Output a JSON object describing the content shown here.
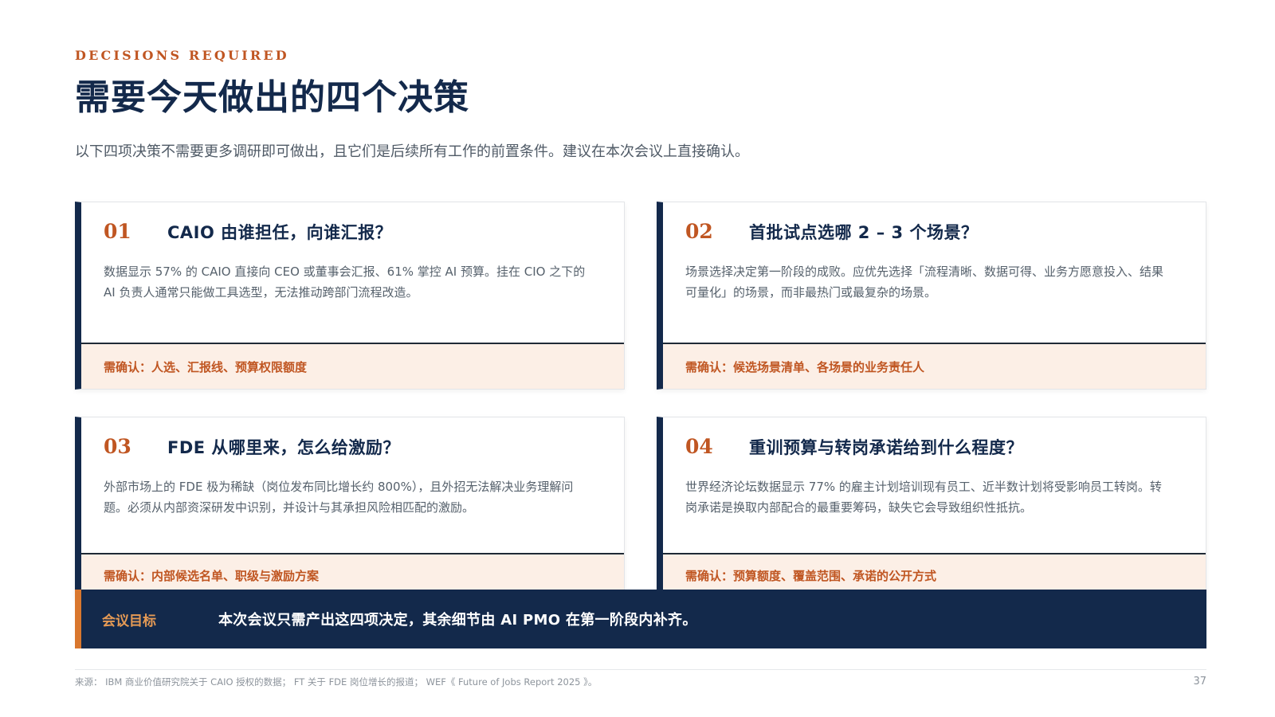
{
  "header": {
    "eyebrow": "DECISIONS REQUIRED",
    "title": "需要今天做出的四个决策",
    "subtitle": "以下四项决策不需要更多调研即可做出，且它们是后续所有工作的前置条件。建议在本次会议上直接确认。"
  },
  "cards": [
    {
      "num": "01",
      "title": "CAIO 由谁担任，向谁汇报？",
      "body": "数据显示 57% 的 CAIO 直接向 CEO 或董事会汇报、61% 掌控 AI 预算。挂在 CIO 之下的 AI 负责人通常只能做工具选型，无法推动跨部门流程改造。",
      "confirm": "需确认：人选、汇报线、预算权限额度"
    },
    {
      "num": "02",
      "title": "首批试点选哪 2 – 3 个场景？",
      "body": "场景选择决定第一阶段的成败。应优先选择「流程清晰、数据可得、业务方愿意投入、结果可量化」的场景，而非最热门或最复杂的场景。",
      "confirm": "需确认：候选场景清单、各场景的业务责任人"
    },
    {
      "num": "03",
      "title": "FDE 从哪里来，怎么给激励？",
      "body": "外部市场上的 FDE 极为稀缺（岗位发布同比增长约 800%），且外招无法解决业务理解问题。必须从内部资深研发中识别，并设计与其承担风险相匹配的激励。",
      "confirm": "需确认：内部候选名单、职级与激励方案"
    },
    {
      "num": "04",
      "title": "重训预算与转岗承诺给到什么程度？",
      "body": "世界经济论坛数据显示 77% 的雇主计划培训现有员工、近半数计划将受影响员工转岗。转岗承诺是换取内部配合的最重要筹码，缺失它会导致组织性抵抗。",
      "confirm": "需确认：预算额度、覆盖范围、承诺的公开方式"
    }
  ],
  "goal": {
    "label": "会议目标",
    "text": "本次会议只需产出这四项决定，其余细节由 AI PMO 在第一阶段内补齐。"
  },
  "footer": {
    "source": "来源： IBM 商业价值研究院关于 CAIO 授权的数据； FT 关于 FDE 岗位增长的报道； WEF《 Future of Jobs Report 2025 》。",
    "page": "37"
  },
  "colors": {
    "navy": "#13294b",
    "accent": "#c05622",
    "confirm_bg": "#fcefe6",
    "goal_bar_edge": "#d9772e"
  }
}
